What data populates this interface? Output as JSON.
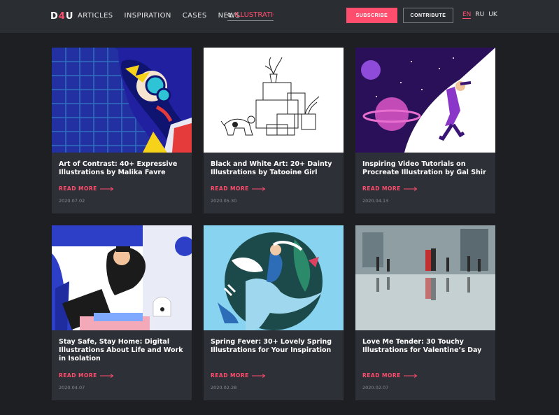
{
  "header": {
    "logo": {
      "left": "D",
      "mid": "4",
      "right": "U"
    },
    "nav": [
      "ARTICLES",
      "INSPIRATION",
      "CASES",
      "NEWS"
    ],
    "search": {
      "value": "ILLUSTRATION",
      "icon": "search-icon"
    },
    "subscribe_label": "SUBSCRIBE",
    "contribute_label": "CONTRIBUTE",
    "languages": [
      {
        "code": "EN",
        "active": true
      },
      {
        "code": "RU",
        "active": false
      },
      {
        "code": "UK",
        "active": false
      }
    ],
    "accent_color": "#ff4d6d"
  },
  "cards": [
    {
      "title": "Art of Contrast: 40+ Expressive Illustrations by Malika Favre",
      "read_more": "READ MORE",
      "date": "2020.07.02"
    },
    {
      "title": "Black and White Art: 20+ Dainty Illustrations by Tatooine Girl",
      "read_more": "READ MORE",
      "date": "2020.05.30"
    },
    {
      "title": "Inspiring Video Tutorials on Procreate Illustration by Gal Shir",
      "read_more": "READ MORE",
      "date": "2020.04.13"
    },
    {
      "title": "Stay Safe, Stay Home: Digital Illustrations About Life and Work in Isolation",
      "read_more": "READ MORE",
      "date": "2020.04.07"
    },
    {
      "title": "Spring Fever: 30+ Lovely Spring Illustrations for Your Inspiration",
      "read_more": "READ MORE",
      "date": "2020.02.28"
    },
    {
      "title": "Love Me Tender: 30 Touchy Illustrations for Valentine’s Day",
      "read_more": "READ MORE",
      "date": "2020.02.07"
    }
  ]
}
